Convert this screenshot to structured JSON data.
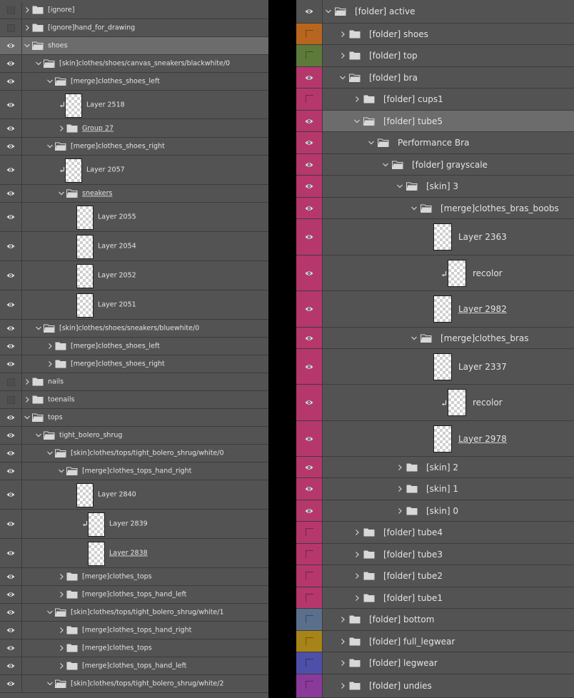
{
  "colors": {
    "orange": "#b8661f",
    "green": "#5d7a3a",
    "magenta": "#b5376c",
    "blue": "#5a6f8c",
    "yellow": "#a78418",
    "indigo": "#4d4fa8",
    "violet": "#8a3a9a",
    "panel_bg": "#535353",
    "row_selected": "#6c6c6c",
    "divider": "#3c3c3c",
    "gap": "#000000"
  },
  "left_panel": {
    "rows": [
      {
        "label": "[ignore]",
        "visible": false,
        "kind": "folder",
        "expanded": false
      },
      {
        "label": "[ignore]hand_for_drawing",
        "visible": false,
        "kind": "folder",
        "expanded": false
      },
      {
        "label": "shoes",
        "visible": true,
        "kind": "folder",
        "expanded": true,
        "selected": true
      },
      {
        "label": "[skin]clothes/shoes/canvas_sneakers/blackwhite/0",
        "visible": true,
        "kind": "folder",
        "expanded": true
      },
      {
        "label": "[merge]clothes_shoes_left",
        "visible": true,
        "kind": "folder",
        "expanded": true
      },
      {
        "label": "Layer 2518",
        "visible": true,
        "kind": "layer",
        "clip": true
      },
      {
        "label": "Group 27",
        "visible": true,
        "kind": "folder",
        "expanded": false,
        "underline": true
      },
      {
        "label": "[merge]clothes_shoes_right",
        "visible": true,
        "kind": "folder",
        "expanded": true
      },
      {
        "label": "Layer 2057",
        "visible": true,
        "kind": "layer",
        "clip": true
      },
      {
        "label": "sneakers",
        "visible": true,
        "kind": "folder",
        "expanded": true,
        "underline": true
      },
      {
        "label": "Layer 2055",
        "visible": true,
        "kind": "layer"
      },
      {
        "label": "Layer 2054",
        "visible": true,
        "kind": "layer"
      },
      {
        "label": "Layer 2052",
        "visible": true,
        "kind": "layer"
      },
      {
        "label": "Layer 2051",
        "visible": true,
        "kind": "layer"
      },
      {
        "label": "[skin]clothes/shoes/sneakers/bluewhite/0",
        "visible": true,
        "kind": "folder",
        "expanded": true
      },
      {
        "label": "[merge]clothes_shoes_left",
        "visible": true,
        "kind": "folder",
        "expanded": false
      },
      {
        "label": "[merge]clothes_shoes_right",
        "visible": true,
        "kind": "folder",
        "expanded": false
      },
      {
        "label": "nails",
        "visible": false,
        "kind": "folder",
        "expanded": false
      },
      {
        "label": "toenails",
        "visible": false,
        "kind": "folder",
        "expanded": false
      },
      {
        "label": "tops",
        "visible": true,
        "kind": "folder",
        "expanded": true
      },
      {
        "label": "tight_bolero_shrug",
        "visible": true,
        "kind": "folder",
        "expanded": true
      },
      {
        "label": "[skin]clothes/tops/tight_bolero_shrug/white/0",
        "visible": true,
        "kind": "folder",
        "expanded": true
      },
      {
        "label": "[merge]clothes_tops_hand_right",
        "visible": true,
        "kind": "folder",
        "expanded": true
      },
      {
        "label": "Layer 2840",
        "visible": true,
        "kind": "layer"
      },
      {
        "label": "Layer 2839",
        "visible": true,
        "kind": "layer",
        "clip": true
      },
      {
        "label": "Layer 2838",
        "visible": true,
        "kind": "layer",
        "underline": true
      },
      {
        "label": "[merge]clothes_tops",
        "visible": true,
        "kind": "folder",
        "expanded": false
      },
      {
        "label": "[merge]clothes_tops_hand_left",
        "visible": true,
        "kind": "folder",
        "expanded": false
      },
      {
        "label": "[skin]clothes/tops/tight_bolero_shrug/white/1",
        "visible": true,
        "kind": "folder",
        "expanded": true
      },
      {
        "label": "[merge]clothes_tops_hand_right",
        "visible": true,
        "kind": "folder",
        "expanded": false
      },
      {
        "label": "[merge]clothes_tops",
        "visible": true,
        "kind": "folder",
        "expanded": false
      },
      {
        "label": "[merge]clothes_tops_hand_left",
        "visible": true,
        "kind": "folder",
        "expanded": false
      },
      {
        "label": "[skin]clothes/tops/tight_bolero_shrug/white/2",
        "visible": true,
        "kind": "folder",
        "expanded": true
      }
    ]
  },
  "right_panel": {
    "rows": [
      {
        "label": "[folder] active",
        "visible": true,
        "kind": "folder",
        "expanded": true
      },
      {
        "label": "[folder] shoes",
        "visible": false,
        "kind": "folder",
        "expanded": false,
        "color": "orange"
      },
      {
        "label": "[folder] top",
        "visible": false,
        "kind": "folder",
        "expanded": false,
        "color": "green"
      },
      {
        "label": "[folder] bra",
        "visible": true,
        "kind": "folder",
        "expanded": true,
        "color": "magenta"
      },
      {
        "label": "[folder] cups1",
        "visible": false,
        "kind": "folder",
        "expanded": false,
        "color": "magenta"
      },
      {
        "label": "[folder] tube5",
        "visible": true,
        "kind": "folder",
        "expanded": true,
        "color": "magenta",
        "selected": true
      },
      {
        "label": "Performance Bra",
        "visible": true,
        "kind": "folder",
        "expanded": true,
        "color": "magenta"
      },
      {
        "label": "[folder] grayscale",
        "visible": true,
        "kind": "folder",
        "expanded": true,
        "color": "magenta"
      },
      {
        "label": "[skin] 3",
        "visible": true,
        "kind": "folder",
        "expanded": true,
        "color": "magenta"
      },
      {
        "label": "[merge]clothes_bras_boobs",
        "visible": true,
        "kind": "folder",
        "expanded": true,
        "color": "magenta"
      },
      {
        "label": "Layer 2363",
        "visible": true,
        "kind": "layer",
        "color": "magenta"
      },
      {
        "label": "recolor",
        "visible": true,
        "kind": "layer",
        "clip": true,
        "color": "magenta"
      },
      {
        "label": "Layer 2982",
        "visible": true,
        "kind": "layer",
        "underline": true,
        "color": "magenta"
      },
      {
        "label": "[merge]clothes_bras",
        "visible": true,
        "kind": "folder",
        "expanded": true,
        "color": "magenta"
      },
      {
        "label": "Layer 2337",
        "visible": true,
        "kind": "layer",
        "color": "magenta"
      },
      {
        "label": "recolor",
        "visible": true,
        "kind": "layer",
        "clip": true,
        "color": "magenta"
      },
      {
        "label": "Layer 2978",
        "visible": true,
        "kind": "layer",
        "underline": true,
        "color": "magenta"
      },
      {
        "label": "[skin] 2",
        "visible": true,
        "kind": "folder",
        "expanded": false,
        "color": "magenta"
      },
      {
        "label": "[skin] 1",
        "visible": true,
        "kind": "folder",
        "expanded": false,
        "color": "magenta"
      },
      {
        "label": "[skin] 0",
        "visible": true,
        "kind": "folder",
        "expanded": false,
        "color": "magenta"
      },
      {
        "label": "[folder] tube4",
        "visible": false,
        "kind": "folder",
        "expanded": false,
        "color": "magenta"
      },
      {
        "label": "[folder] tube3",
        "visible": false,
        "kind": "folder",
        "expanded": false,
        "color": "magenta"
      },
      {
        "label": "[folder] tube2",
        "visible": false,
        "kind": "folder",
        "expanded": false,
        "color": "magenta"
      },
      {
        "label": "[folder] tube1",
        "visible": false,
        "kind": "folder",
        "expanded": false,
        "color": "magenta"
      },
      {
        "label": "[folder] bottom",
        "visible": false,
        "kind": "folder",
        "expanded": false,
        "color": "blue"
      },
      {
        "label": "[folder] full_legwear",
        "visible": false,
        "kind": "folder",
        "expanded": false,
        "color": "yellow"
      },
      {
        "label": "[folder] legwear",
        "visible": false,
        "kind": "folder",
        "expanded": false,
        "color": "indigo"
      },
      {
        "label": "[folder] undies",
        "visible": false,
        "kind": "folder",
        "expanded": false,
        "color": "violet"
      }
    ]
  }
}
